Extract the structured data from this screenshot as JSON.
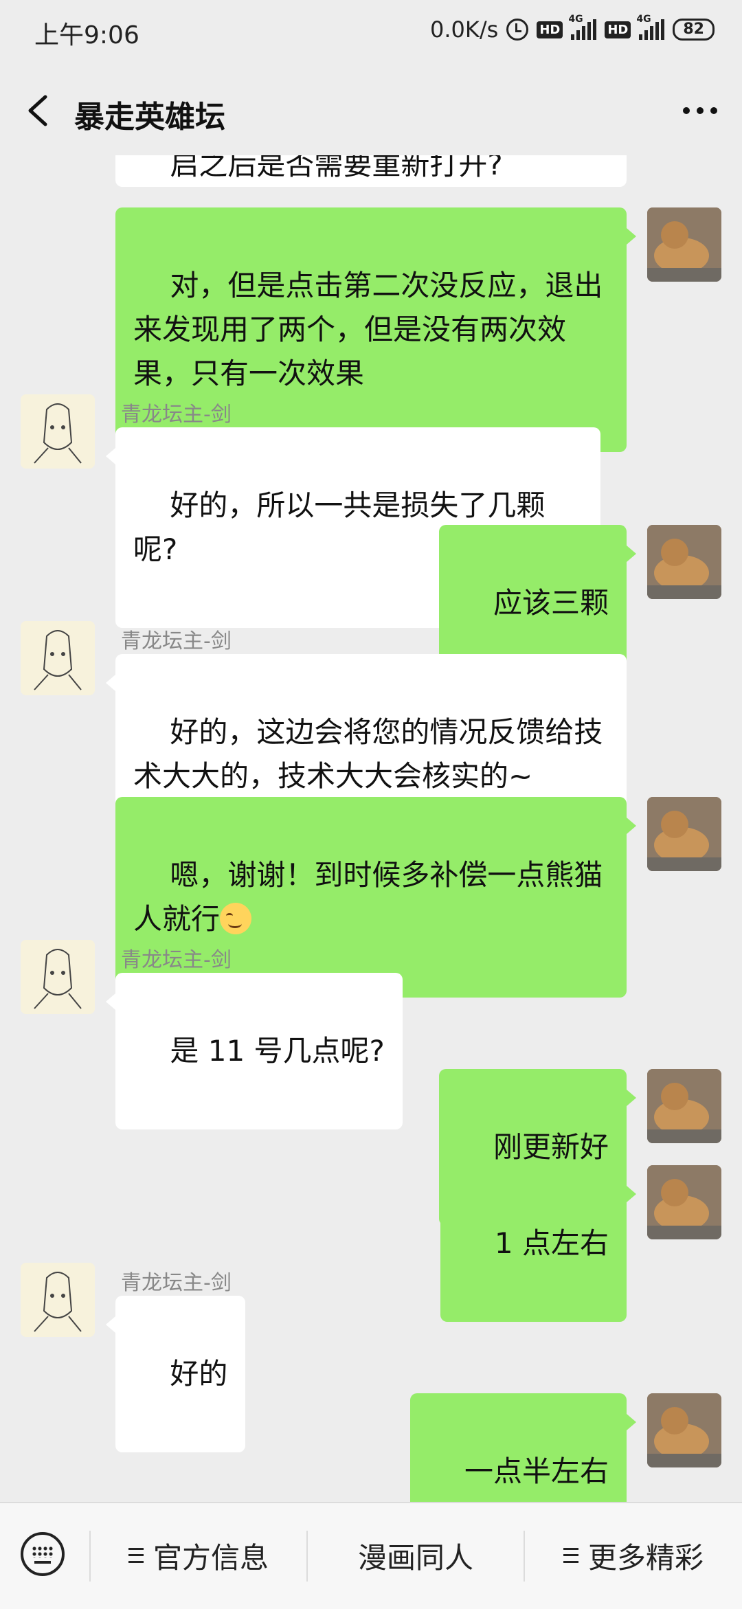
{
  "status_bar": {
    "time": "上午9:06",
    "net_speed": "0.0K/s",
    "hd1": "HD",
    "hd2": "HD",
    "net1": "4G",
    "net2": "4G",
    "battery": "82"
  },
  "header": {
    "title": "暴走英雄坛"
  },
  "messages": [
    {
      "side": "out",
      "text": "启之后是否需要重新打开?"
    },
    {
      "side": "out",
      "text": "对，但是点击第二次没反应，退出来发现用了两个，但是没有两次效果，只有一次效果"
    },
    {
      "side": "in",
      "sender": "青龙坛主-剑",
      "text": "好的，所以一共是损失了几颗呢?"
    },
    {
      "side": "out",
      "text": "应该三颗"
    },
    {
      "side": "in",
      "sender": "青龙坛主-剑",
      "text": "好的，这边会将您的情况反馈给技术大大的，技术大大会核实的~"
    },
    {
      "side": "out",
      "text": "嗯，谢谢！到时候多补偿一点熊猫人就行",
      "emoji": "smiling-face"
    },
    {
      "side": "in",
      "sender": "青龙坛主-剑",
      "text": "是 11 号几点呢?"
    },
    {
      "side": "out",
      "text": "刚更新好"
    },
    {
      "side": "out",
      "text": "1 点左右"
    },
    {
      "side": "in",
      "sender": "青龙坛主-剑",
      "text": "好的"
    },
    {
      "side": "out",
      "text": "一点半左右"
    }
  ],
  "bottom_menu": {
    "item1": "官方信息",
    "item2": "漫画同人",
    "item3": "更多精彩"
  },
  "colors": {
    "outgoing_bubble": "#95ec69",
    "incoming_bubble": "#ffffff",
    "background": "#ededed"
  }
}
